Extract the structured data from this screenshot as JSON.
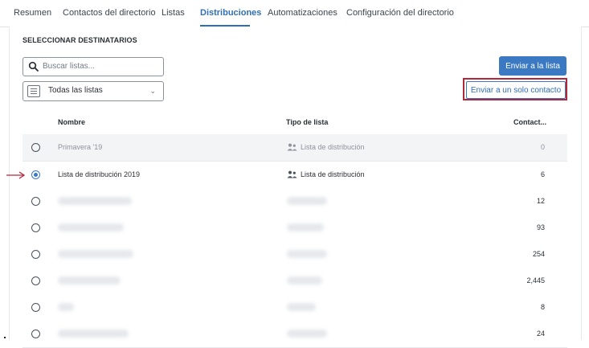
{
  "nav": {
    "tabs": [
      {
        "label": "Resumen"
      },
      {
        "label": "Contactos del directorio"
      },
      {
        "label": "Listas"
      },
      {
        "label": "Distribuciones"
      },
      {
        "label": "Automatizaciones"
      },
      {
        "label": "Configuración del directorio"
      }
    ],
    "active": "Distribuciones"
  },
  "section_title": "SELECCIONAR DESTINATARIOS",
  "search": {
    "placeholder": "Buscar listas..."
  },
  "filter": {
    "selected": "Todas las listas"
  },
  "buttons": {
    "send_to_list": "Enviar a la lista",
    "send_to_single": "Enviar a un solo contacto"
  },
  "table": {
    "headers": {
      "name": "Nombre",
      "type": "Tipo de lista",
      "count": "Contact..."
    },
    "rows": [
      {
        "name": "Primavera '19",
        "type": "Lista de distribución",
        "count": "0",
        "disabled": true,
        "selected": false
      },
      {
        "name": "Lista de distribución 2019",
        "type": "Lista de distribución",
        "count": "6",
        "disabled": false,
        "selected": true
      },
      {
        "name": "",
        "type": "",
        "count": "12",
        "disabled": false,
        "selected": false
      },
      {
        "name": "",
        "type": "",
        "count": "93",
        "disabled": false,
        "selected": false
      },
      {
        "name": "",
        "type": "",
        "count": "254",
        "disabled": false,
        "selected": false
      },
      {
        "name": "",
        "type": "",
        "count": "2,445",
        "disabled": false,
        "selected": false
      },
      {
        "name": "",
        "type": "",
        "count": "8",
        "disabled": false,
        "selected": false
      },
      {
        "name": "",
        "type": "",
        "count": "24",
        "disabled": false,
        "selected": false
      }
    ]
  },
  "colors": {
    "accent": "#3b79c3",
    "highlight": "#b3273a",
    "arrow": "#b3273a"
  },
  "icons": [
    "search-icon",
    "list-icon",
    "chevron-down-icon",
    "people-icon",
    "arrow-right-icon"
  ]
}
